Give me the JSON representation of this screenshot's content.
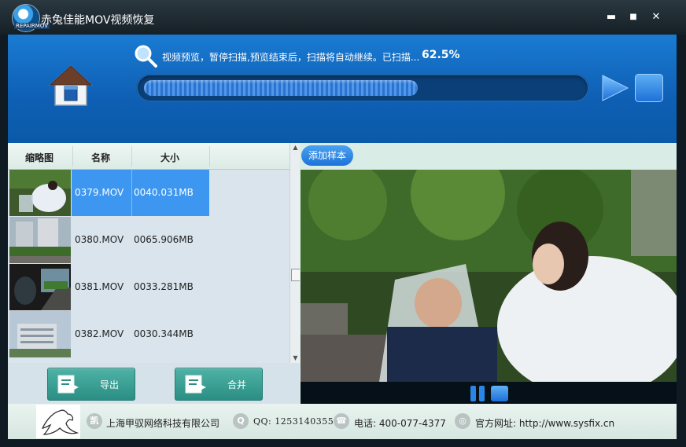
{
  "window": {
    "title": "赤兔佳能MOV视频恢复",
    "logo_tag": "REPAIRMOV",
    "min_label": "▬",
    "max_label": "■",
    "close_label": "✕"
  },
  "scan": {
    "status_text": "视频预览，暂停扫描,预览结束后，扫描将自动继续。已扫描...",
    "percent_text": "62.5%",
    "progress_fraction": 0.625
  },
  "list": {
    "columns": [
      "缩略图",
      "名称",
      "大小"
    ],
    "rows": [
      {
        "name": "0379.MOV",
        "size": "0040.031MB",
        "selected": true
      },
      {
        "name": "0380.MOV",
        "size": "0065.906MB",
        "selected": false
      },
      {
        "name": "0381.MOV",
        "size": "0033.281MB",
        "selected": false
      },
      {
        "name": "0382.MOV",
        "size": "0030.344MB",
        "selected": false
      }
    ],
    "export_label": "导出",
    "merge_label": "合并"
  },
  "preview": {
    "add_sample_label": "添加样本"
  },
  "footer": {
    "company": "上海甲驭网络科技有限公司",
    "qq": "QQ: 1253140355",
    "phone": "电话: 400-077-4377",
    "website": "官方网址: http://www.sysfix.cn"
  },
  "colors": {
    "accent": "#1d73d8",
    "header_blue": "#0e5fb4",
    "selected_row": "#3d96f0",
    "button_green": "#2b8e84"
  }
}
